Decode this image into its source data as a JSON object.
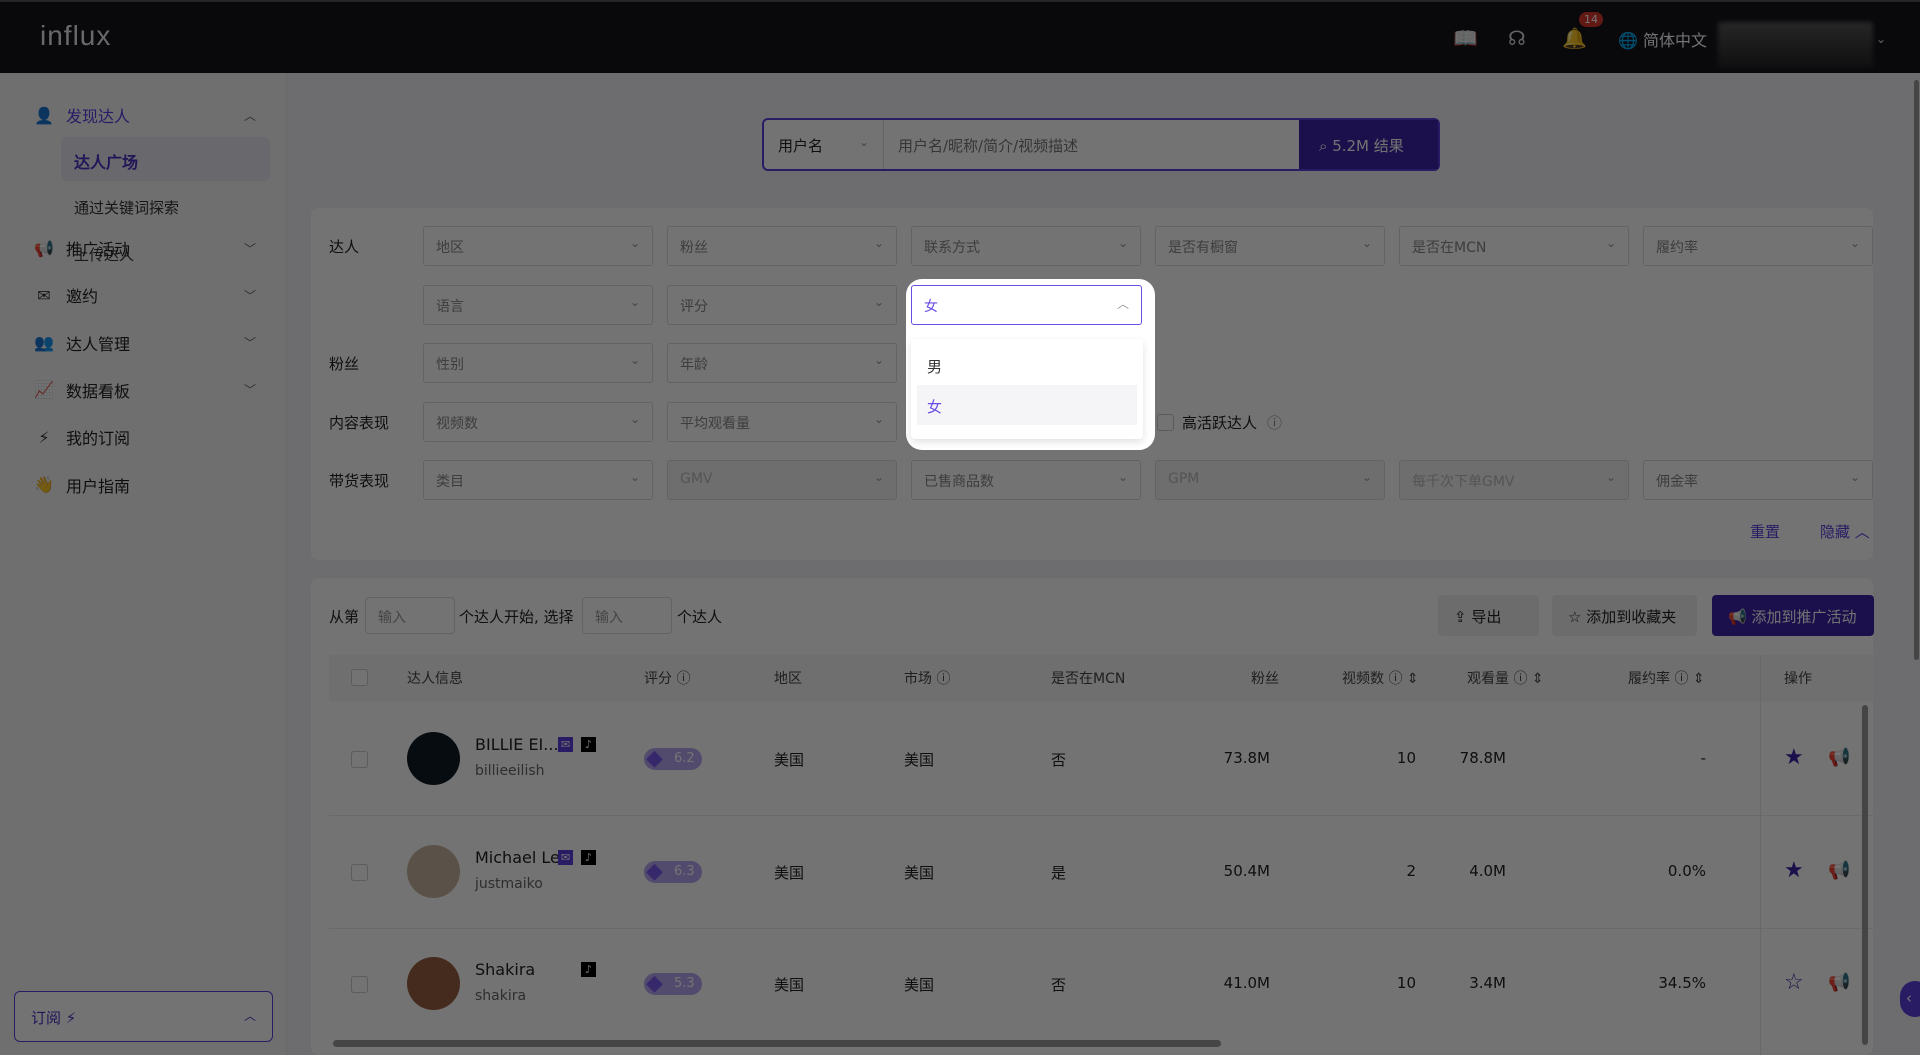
{
  "header": {
    "logo": "influx",
    "notifications": "14",
    "language": "简体中文"
  },
  "sidebar": {
    "discover": "发现达人",
    "sub": [
      "达人广场",
      "通过关键词探索",
      "上传达人"
    ],
    "items": [
      {
        "label": "推广活动",
        "icon": "megaphone-icon"
      },
      {
        "label": "邀约",
        "icon": "mail-icon"
      },
      {
        "label": "达人管理",
        "icon": "users-icon"
      },
      {
        "label": "数据看板",
        "icon": "chart-icon"
      },
      {
        "label": "我的订阅",
        "icon": "lightning-icon"
      },
      {
        "label": "用户指南",
        "icon": "wave-hand-icon"
      }
    ],
    "subscribe": "订阅"
  },
  "search": {
    "type": "用户名",
    "placeholder": "用户名/昵称/简介/视频描述",
    "button": "5.2M 结果"
  },
  "filters": {
    "rows": [
      {
        "label": "达人",
        "selects": [
          "地区",
          "粉丝",
          "联系方式",
          "是否有橱窗",
          "是否在MCN",
          "履约率"
        ]
      },
      {
        "label": "",
        "selects": [
          "语言",
          "评分"
        ]
      },
      {
        "label": "粉丝",
        "selects": [
          "性别",
          "年龄"
        ]
      },
      {
        "label": "内容表现",
        "selects": [
          "视频数",
          "平均观看量"
        ]
      },
      {
        "label": "带货表现",
        "selects": [
          "类目",
          "GMV",
          "已售商品数",
          "GPM",
          "每千次下单GMV",
          "佣金率"
        ]
      }
    ],
    "active_checkbox": "高活跃达人",
    "reset": "重置",
    "hide": "隐藏",
    "open_select": {
      "value": "女",
      "options": [
        "男",
        "女"
      ]
    }
  },
  "toolbar": {
    "from": "从第",
    "start": "个达人开始, 选择",
    "end": "个达人",
    "placeholder": "输入",
    "export": "导出",
    "favorite": "添加到收藏夹",
    "add_campaign": "添加到推广活动"
  },
  "table": {
    "headers": [
      "达人信息",
      "评分",
      "地区",
      "市场",
      "是否在MCN",
      "粉丝",
      "视频数",
      "观看量",
      "履约率",
      "操作"
    ],
    "rows": [
      {
        "name": "BILLIE EI...",
        "handle": "billieeilish",
        "score": "6.2",
        "region": "美国",
        "market": "美国",
        "mcn": "否",
        "fans": "73.8M",
        "videos": "10",
        "views": "78.8M",
        "rate": "-",
        "fav": true,
        "mail": true
      },
      {
        "name": "Michael Le",
        "handle": "justmaiko",
        "score": "6.3",
        "region": "美国",
        "market": "美国",
        "mcn": "是",
        "fans": "50.4M",
        "videos": "2",
        "views": "4.0M",
        "rate": "0.0%",
        "fav": true,
        "mail": true
      },
      {
        "name": "Shakira",
        "handle": "shakira",
        "score": "5.3",
        "region": "美国",
        "market": "美国",
        "mcn": "否",
        "fans": "41.0M",
        "videos": "10",
        "views": "3.4M",
        "rate": "34.5%",
        "fav": false,
        "mail": false
      }
    ]
  },
  "colors": {
    "accent": "#5b3ee0",
    "dark": "#3b23a8"
  }
}
